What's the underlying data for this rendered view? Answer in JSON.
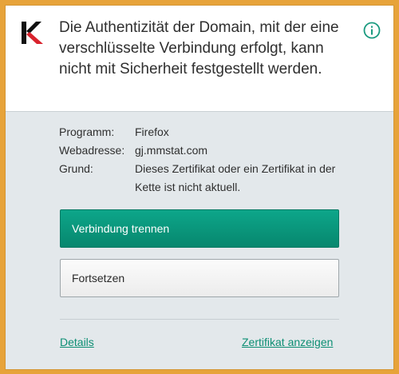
{
  "header": {
    "logo_icon": "kaspersky-logo-icon",
    "message": "Die Authentizität der Domain, mit der eine verschlüsselte Verbindung erfolgt, kann nicht mit Sicherheit festgestellt werden.",
    "info_icon": "info-icon"
  },
  "details": {
    "rows": [
      {
        "label": "Programm:",
        "value": "Firefox"
      },
      {
        "label": "Webadresse:",
        "value": "gj.mmstat.com"
      },
      {
        "label": "Grund:",
        "value": "Dieses Zertifikat oder ein Zertifikat in der Kette ist nicht aktuell."
      }
    ]
  },
  "actions": {
    "disconnect_label": "Verbindung trennen",
    "continue_label": "Fortsetzen"
  },
  "footer": {
    "details_link": "Details",
    "certificate_link": "Zertifikat anzeigen"
  },
  "colors": {
    "accent": "#0a9a80",
    "link": "#0e8f74",
    "window_border": "#e7a33a",
    "logo_red": "#d9232d"
  }
}
